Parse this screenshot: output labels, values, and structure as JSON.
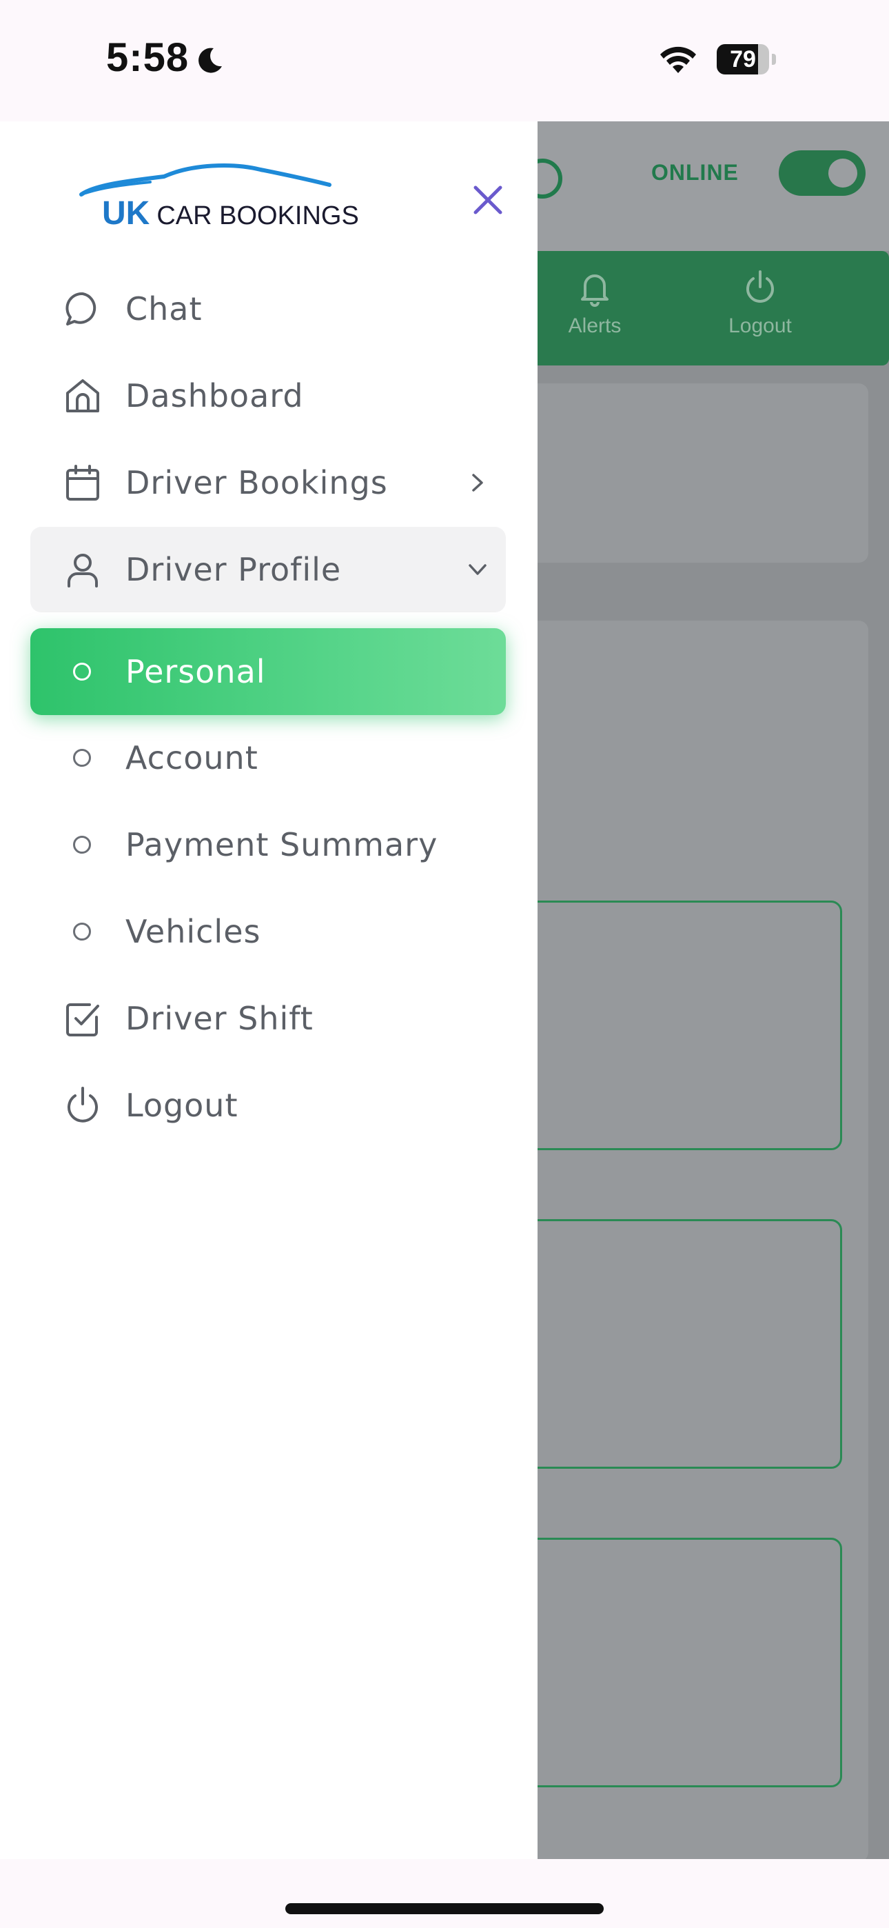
{
  "status_bar": {
    "time": "5:58",
    "battery": "79",
    "battery_level_percent": 79
  },
  "background": {
    "online_label": "ONLINE",
    "nav": {
      "alerts_label": "Alerts",
      "logout_label": "Logout"
    }
  },
  "drawer": {
    "logo": {
      "uk": "UK",
      "rest": "CAR BOOKINGS"
    },
    "menu": {
      "chat": "Chat",
      "dashboard": "Dashboard",
      "driver_bookings": "Driver Bookings",
      "driver_profile": "Driver Profile",
      "personal": "Personal",
      "account": "Account",
      "payment_summary": "Payment Summary",
      "vehicles": "Vehicles",
      "driver_shift": "Driver Shift",
      "logout": "Logout"
    }
  },
  "colors": {
    "accent_green": "#2ec36b",
    "close_icon": "#6a5acd",
    "logo_blue": "#1e78c8"
  }
}
